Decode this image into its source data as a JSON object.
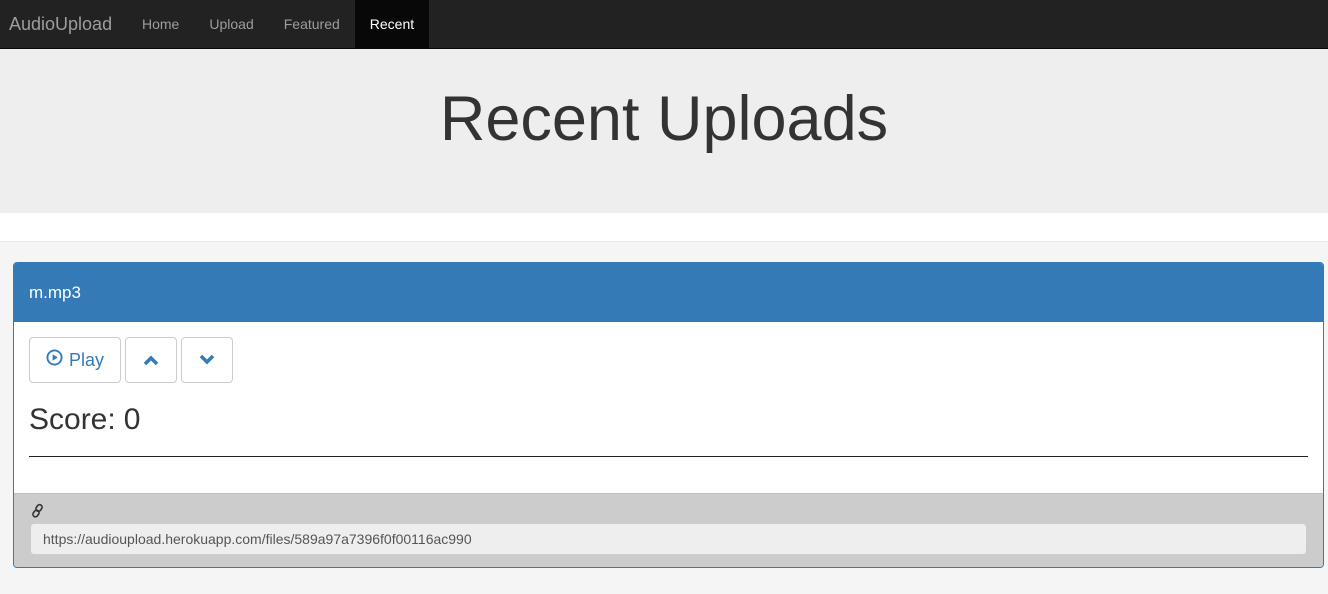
{
  "navbar": {
    "brand": "AudioUpload",
    "items": [
      {
        "label": "Home",
        "active": false
      },
      {
        "label": "Upload",
        "active": false
      },
      {
        "label": "Featured",
        "active": false
      },
      {
        "label": "Recent",
        "active": true
      }
    ]
  },
  "jumbotron": {
    "title": "Recent Uploads"
  },
  "upload": {
    "filename": "m.mp3",
    "play_label": "Play",
    "play_icon": "play-circle-icon",
    "upvote_icon": "chevron-up-icon",
    "downvote_icon": "chevron-down-icon",
    "score_label": "Score:",
    "score_value": "0",
    "link_icon": "link-icon",
    "url": "https://audioupload.herokuapp.com/files/589a97a7396f0f00116ac990"
  },
  "colors": {
    "navbar_bg": "#222222",
    "panel_primary": "#337ab7",
    "jumbotron_bg": "#eeeeee",
    "footer_bg": "#cccccc"
  }
}
